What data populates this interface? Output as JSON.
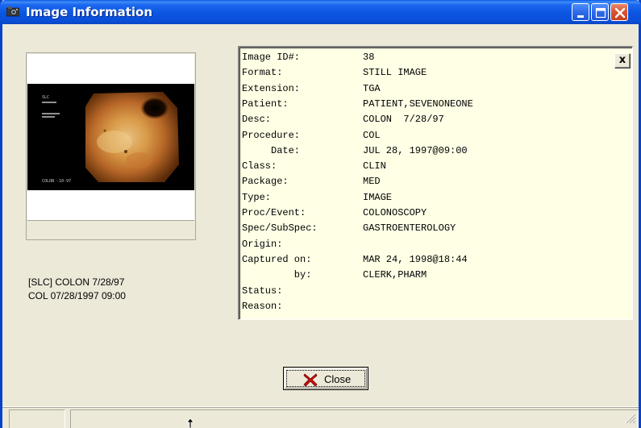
{
  "window": {
    "title": "Image Information"
  },
  "thumbnail": {
    "overlay_left_top": "SLC",
    "overlay_bottom": "COLON -10-97"
  },
  "image_caption": {
    "line1": "[SLC] COLON  7/28/97",
    "line2": "COL 07/28/1997 09:00"
  },
  "info_panel": {
    "close_label": "x",
    "rows": [
      {
        "label": "Image ID#:",
        "value": "38"
      },
      {
        "label": "Format:",
        "value": "STILL IMAGE"
      },
      {
        "label": "Extension:",
        "value": "TGA"
      },
      {
        "label": "Patient:",
        "value": "PATIENT,SEVENONEONE"
      },
      {
        "label": "Desc:",
        "value": "COLON  7/28/97"
      },
      {
        "label": "Procedure:",
        "value": "COL"
      },
      {
        "label": "     Date:",
        "value": "JUL 28, 1997@09:00"
      },
      {
        "label": "Class:",
        "value": "CLIN"
      },
      {
        "label": "Package:",
        "value": "MED"
      },
      {
        "label": "Type:",
        "value": "IMAGE"
      },
      {
        "label": "Proc/Event:",
        "value": "COLONOSCOPY"
      },
      {
        "label": "Spec/SubSpec:",
        "value": "GASTROENTEROLOGY"
      },
      {
        "label": "Origin:",
        "value": ""
      },
      {
        "label": "Captured on:",
        "value": "MAR 24, 1998@18:44"
      },
      {
        "label": "         by:",
        "value": "CLERK,PHARM"
      },
      {
        "label": "Status:",
        "value": ""
      },
      {
        "label": "Reason:",
        "value": ""
      }
    ]
  },
  "footer": {
    "close_button_label": "Close"
  },
  "colors": {
    "panel_bg": "#ffffe6",
    "window_bg": "#ece9d8",
    "titlebar": "#0a55e2"
  }
}
